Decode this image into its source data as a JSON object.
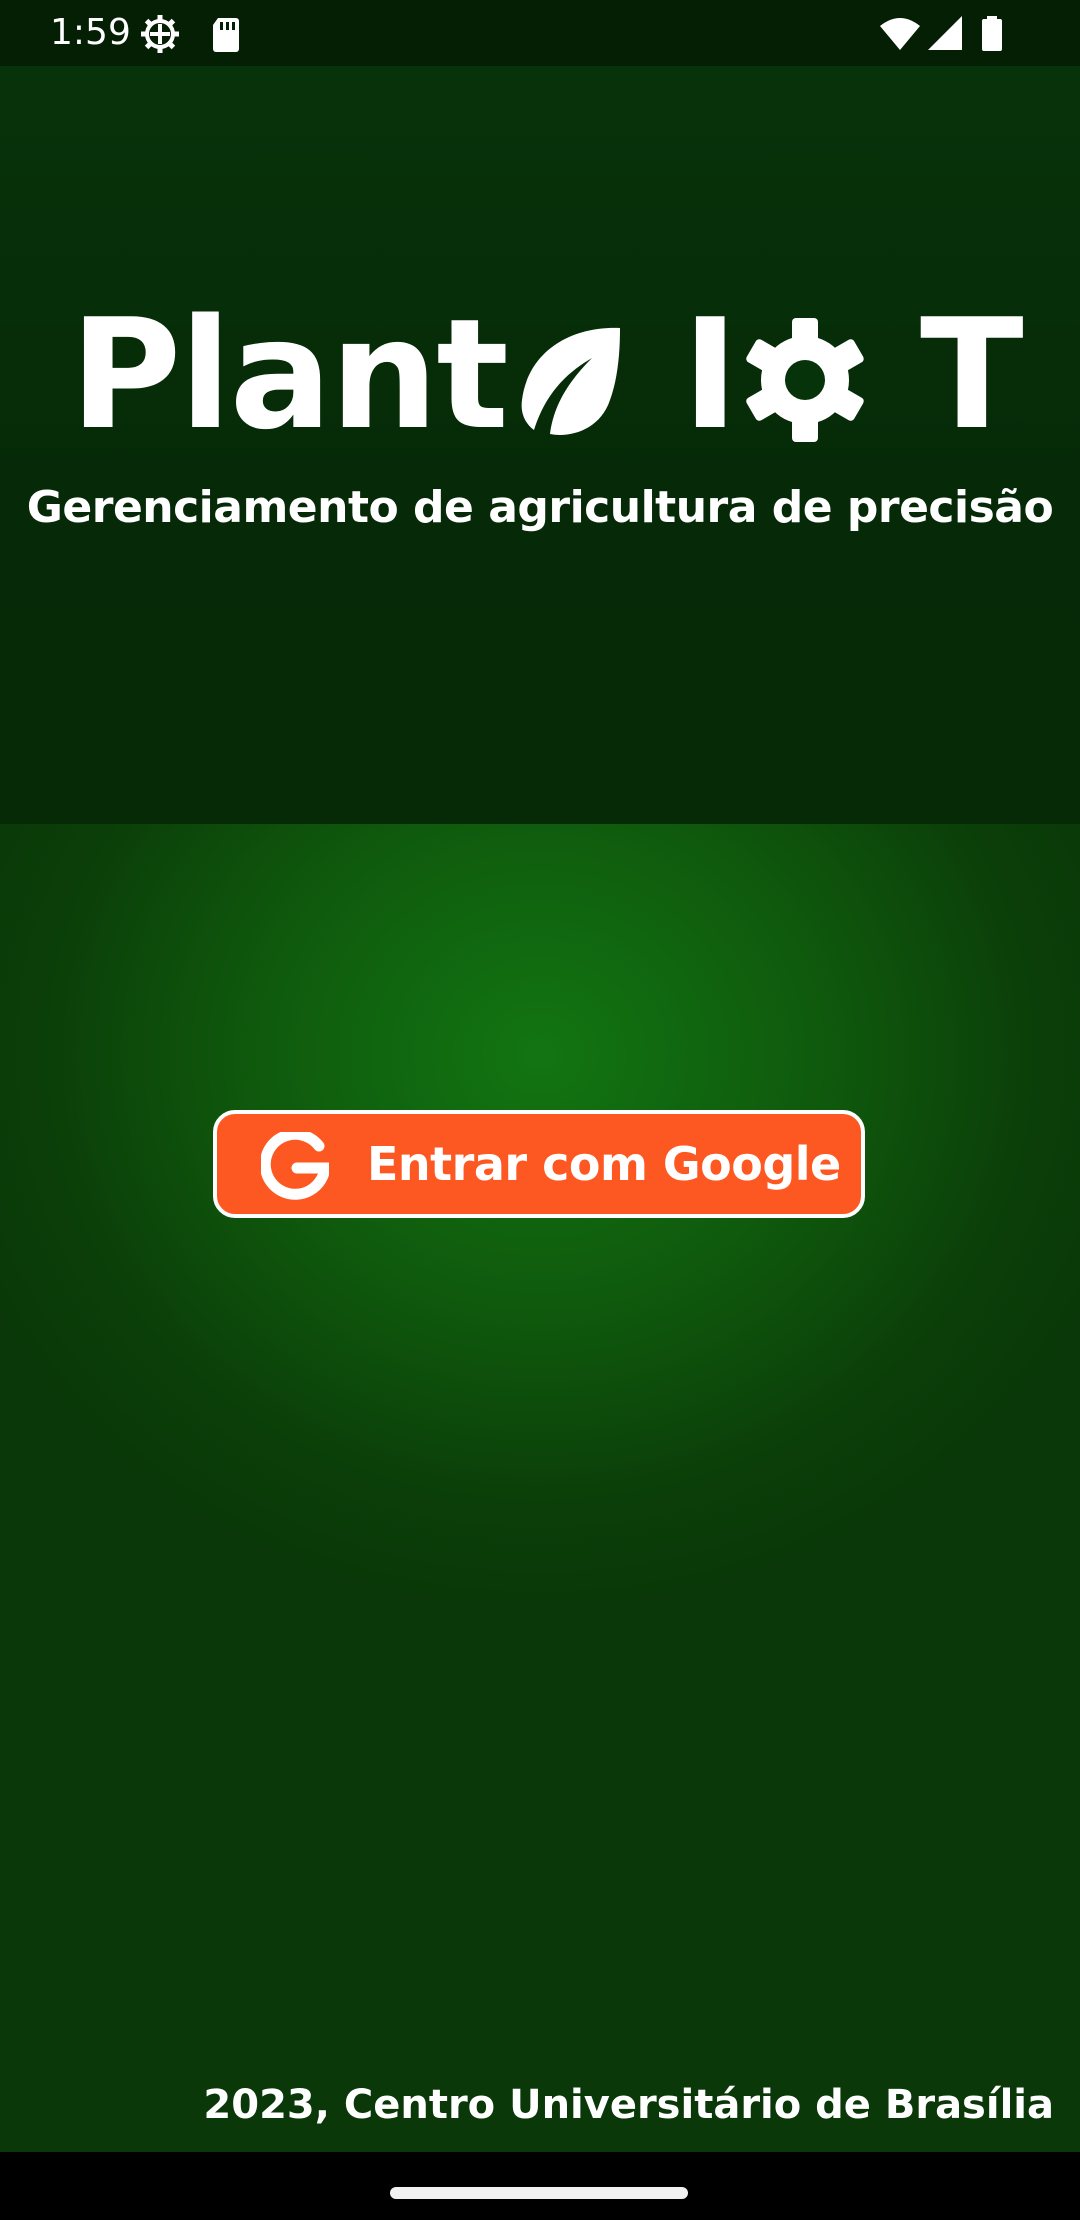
{
  "status_bar": {
    "time": "1:59",
    "left_icons": [
      "settings-gear-icon",
      "sd-card-icon"
    ],
    "right_icons": [
      "wifi-icon",
      "cell-signal-icon",
      "battery-icon"
    ]
  },
  "app": {
    "logo_word_1": "Plant",
    "logo_word_2": "I",
    "logo_word_3": "T",
    "logo_icons": [
      "leaf-icon",
      "gear-icon"
    ],
    "subtitle": "Gerenciamento de agricultura de precisão"
  },
  "login": {
    "google_button_label": "Entrar com Google",
    "google_icon": "google-g-icon"
  },
  "footer": {
    "text": "2023, Centro Universitário de Brasília"
  },
  "colors": {
    "header_bg": "#07330a",
    "main_bg_center": "#127512",
    "main_bg_edge": "#0a3808",
    "button_bg": "#fd5822",
    "button_border": "#ffffff",
    "text": "#ffffff"
  }
}
